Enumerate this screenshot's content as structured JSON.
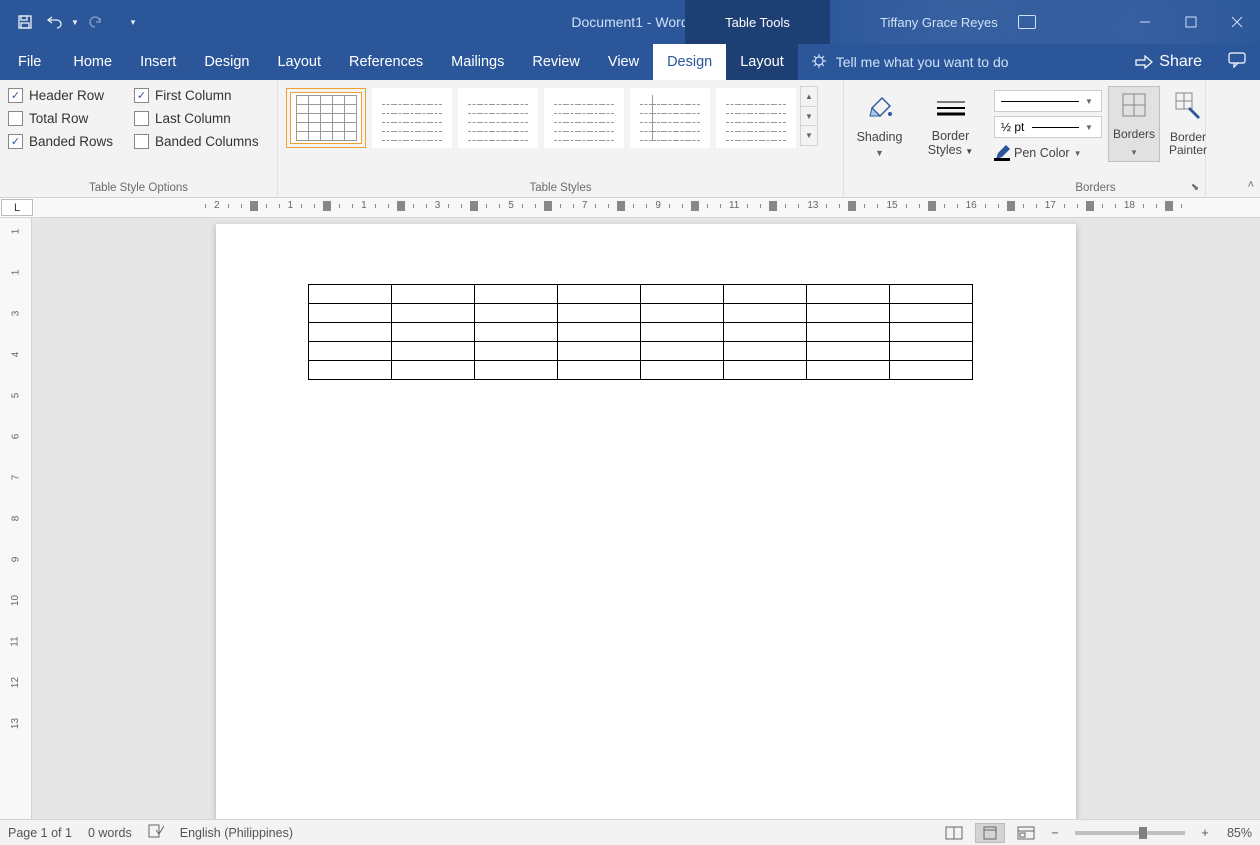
{
  "title": {
    "doc": "Document1  -  Word",
    "table_tools": "Table Tools",
    "user": "Tiffany Grace Reyes"
  },
  "tabs": {
    "file": "File",
    "home": "Home",
    "insert": "Insert",
    "design1": "Design",
    "layout1": "Layout",
    "references": "References",
    "mailings": "Mailings",
    "review": "Review",
    "view": "View",
    "design2": "Design",
    "layout2": "Layout"
  },
  "tellme": "Tell me what you want to do",
  "share": "Share",
  "tso": {
    "header_row": "Header Row",
    "first_col": "First Column",
    "total_row": "Total Row",
    "last_col": "Last Column",
    "banded_rows": "Banded Rows",
    "banded_cols": "Banded Columns",
    "group_label": "Table Style Options",
    "checked": {
      "header_row": true,
      "first_col": true,
      "total_row": false,
      "last_col": false,
      "banded_rows": true,
      "banded_cols": false
    }
  },
  "table_styles_label": "Table Styles",
  "shading": "Shading",
  "border_styles": "Border\nStyles",
  "pen_weight": "½ pt",
  "pen_color": "Pen Color",
  "borders_label": "Borders",
  "borders_btn": "Borders",
  "border_painter": "Border\nPainter",
  "ruler_corner": "L",
  "hruler_nums": [
    "2",
    "1",
    "1",
    "3",
    "5",
    "7",
    "9",
    "11",
    "13",
    "15",
    "16",
    "17",
    "18"
  ],
  "vruler_nums": [
    "1",
    "1",
    "3",
    "4",
    "5",
    "6",
    "7",
    "8",
    "9",
    "10",
    "11",
    "12",
    "13"
  ],
  "status": {
    "page": "Page 1 of 1",
    "words": "0 words",
    "lang": "English (Philippines)",
    "zoom": "85%"
  },
  "doc_table": {
    "rows": 5,
    "cols": 8
  }
}
